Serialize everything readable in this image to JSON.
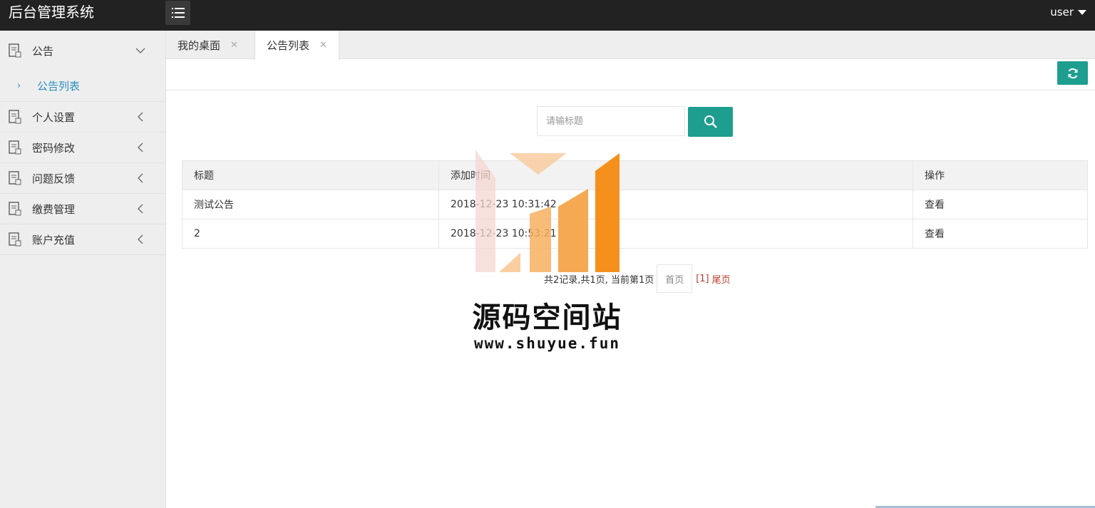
{
  "header": {
    "app_title": "后台管理系统",
    "user_label": "user"
  },
  "sidebar": {
    "items": [
      {
        "label": "公告",
        "expanded": true,
        "children": [
          {
            "label": "公告列表"
          }
        ]
      },
      {
        "label": "个人设置"
      },
      {
        "label": "密码修改"
      },
      {
        "label": "问题反馈"
      },
      {
        "label": "缴费管理"
      },
      {
        "label": "账户充值"
      }
    ]
  },
  "tabs": [
    {
      "label": "我的桌面",
      "active": false
    },
    {
      "label": "公告列表",
      "active": true
    }
  ],
  "search": {
    "placeholder": "请输标题"
  },
  "table": {
    "columns": [
      "标题",
      "添加时间",
      "操作"
    ],
    "rows": [
      {
        "title": "测试公告",
        "time": "2018-12-23 10:31:42",
        "action": "查看"
      },
      {
        "title": "2",
        "time": "2018-12-23 10:53:21",
        "action": "查看"
      }
    ]
  },
  "pagination": {
    "summary": "共2记录,共1页, 当前第1页",
    "first": "首页",
    "current": "[1]",
    "last": "尾页"
  },
  "watermark": {
    "title": "源码空间站",
    "url": "www.shuyue.fun"
  },
  "colors": {
    "accent": "#1e9e8f",
    "topbar": "#222222",
    "link": "#2a8fbd",
    "pager_link": "#c0392b"
  }
}
